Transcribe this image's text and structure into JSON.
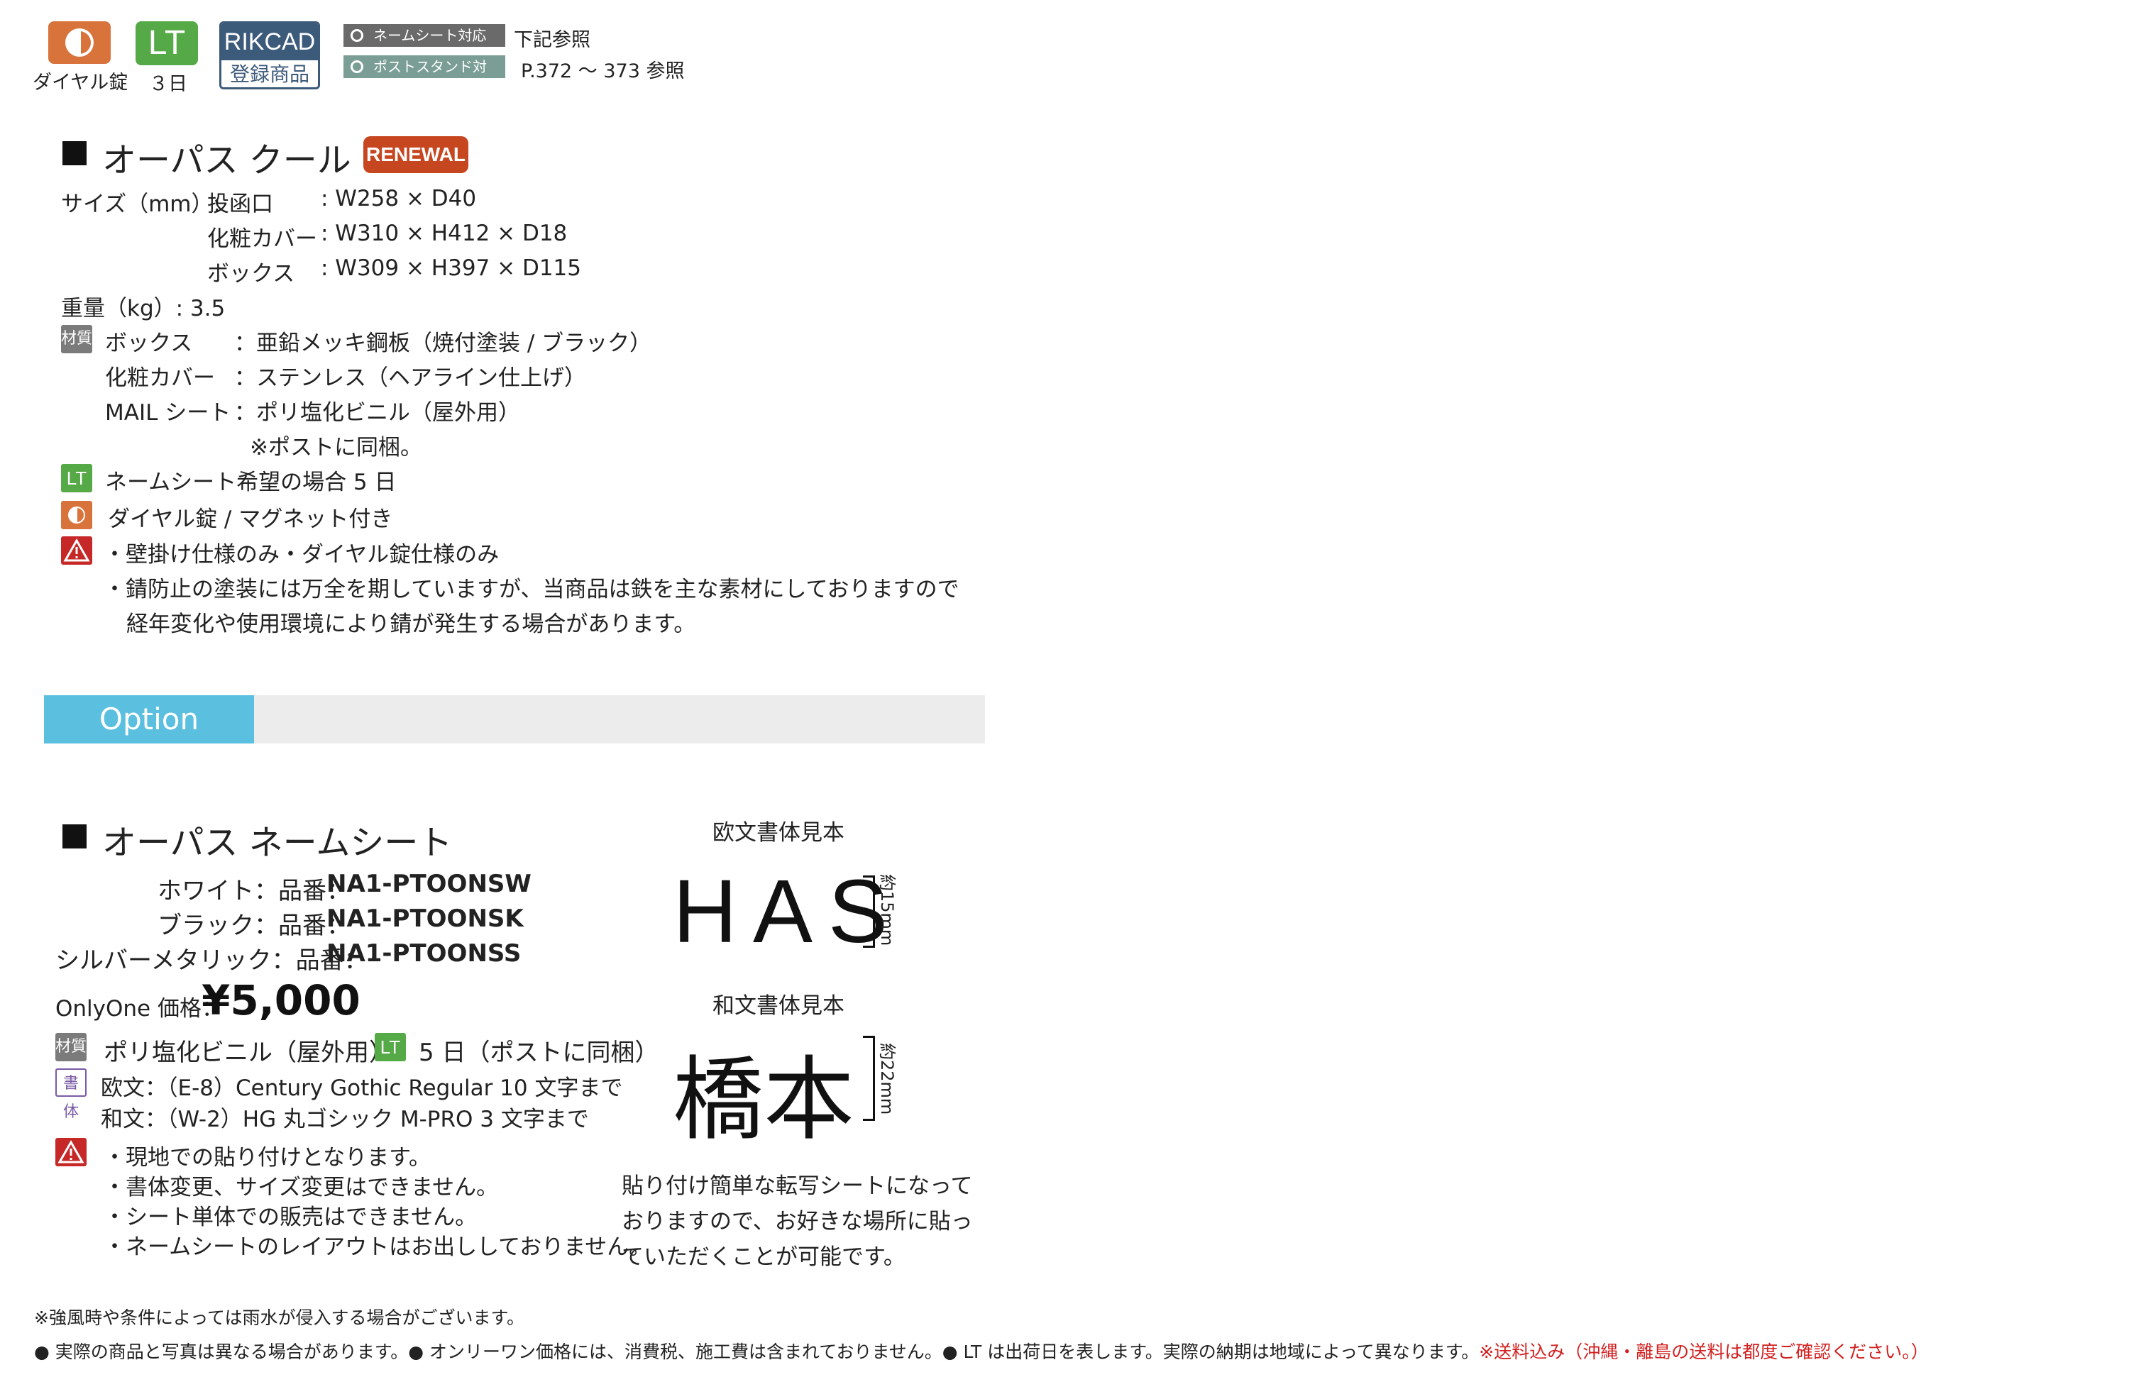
{
  "badges": {
    "dial_label": "ダイヤル錠",
    "lt_text": "LT",
    "lt_days": "３日",
    "rikcad_top": "RIKCAD",
    "rikcad_bottom": "登録商品",
    "tag_namesheet": "ネームシート対応",
    "tag_namesheet_note": "下記参照",
    "tag_poststand": "ポストスタンド対応",
    "tag_poststand_note": "P.372 〜 373 参照"
  },
  "product": {
    "title": "オーパス クール",
    "badge": "RENEWAL",
    "size_label": "サイズ（mm）:",
    "size_rows": [
      {
        "name": "投函口",
        "value": ": W258 × D40"
      },
      {
        "name": "化粧カバー",
        "value": ": W310 × H412 × D18"
      },
      {
        "name": "ボックス",
        "value": ": W309 × H397 × D115"
      }
    ],
    "weight": "重量（kg）: 3.5",
    "material_icon": "材質",
    "materials": [
      {
        "name": "ボックス",
        "value": "：亜鉛メッキ鋼板（焼付塗装 / ブラック）"
      },
      {
        "name": "化粧カバー",
        "value": "：ステンレス（ヘアライン仕上げ）"
      },
      {
        "name": "MAIL シート",
        "value": "：ポリ塩化ビニル（屋外用）"
      }
    ],
    "material_note": "※ポストに同梱。",
    "lt_icon": "LT",
    "lt_note": "ネームシート希望の場合 5 日",
    "dial_note": "ダイヤル錠 / マグネット付き",
    "warnings": [
      "・壁掛け仕様のみ・ダイヤル錠仕様のみ",
      "・錆防止の塗装には万全を期していますが、当商品は鉄を主な素材にしておりますので",
      "経年変化や使用環境により錆が発生する場合があります。"
    ]
  },
  "option": {
    "label": "Option"
  },
  "namesheet": {
    "title": "オーパス ネームシート",
    "variants": [
      {
        "color": "ホワイト：品番：",
        "code": "NA1-PTOONSW"
      },
      {
        "color": "ブラック：品番：",
        "code": "NA1-PTOONSK"
      },
      {
        "color": "シルバーメタリック：品番：",
        "code": "NA1-PTOONSS"
      }
    ],
    "price_label": "OnlyOne 価格：",
    "price": "¥5,000",
    "material_icon": "材質",
    "material": "ポリ塩化ビニル（屋外用）",
    "lt_icon": "LT",
    "lt_note": "5 日（ポストに同梱）",
    "font_icon": "書体",
    "font_en": "欧文：（E-8）Century Gothic Regular  10 文字まで",
    "font_jp": "和文：（W-2）HG 丸ゴシック M-PRO  3 文字まで",
    "warnings": [
      "・現地での貼り付けとなります。",
      "・書体変更、サイズ変更はできません。",
      "・シート単体での販売はできません。",
      "・ネームシートのレイアウトはお出ししておりません。"
    ],
    "sample_en_label": "欧文書体見本",
    "sample_en": "HAS",
    "sample_en_size": "約15mm",
    "sample_jp_label": "和文書体見本",
    "sample_jp": "橋本",
    "sample_jp_size": "約22mm",
    "description": [
      "貼り付け簡単な転写シートになって",
      "おりますので、お好きな場所に貼っ",
      "ていただくことが可能です。"
    ]
  },
  "footer": {
    "note": "※強風時や条件によっては雨水が侵入する場合がございます。",
    "disclaimer": "● 実際の商品と写真は異なる場合があります。● オンリーワン価格には、消費税、施工費は含まれておりません。● LT は出荷日を表します。実際の納期は地域によって異なります。",
    "shipping": "※送料込み（沖縄・離島の送料は都度ご確認ください。）"
  },
  "colors": {
    "dial": "#d9733c",
    "lt": "#55a946",
    "rikcad": "#3c5a7a",
    "renewal": "#c6461f",
    "option": "#5bbfe0",
    "warning": "#c62828",
    "shipping_note": "#d21f1f"
  },
  "icons": [
    "dial-lock-icon",
    "lead-time-icon",
    "material-icon",
    "warning-icon",
    "font-icon"
  ]
}
